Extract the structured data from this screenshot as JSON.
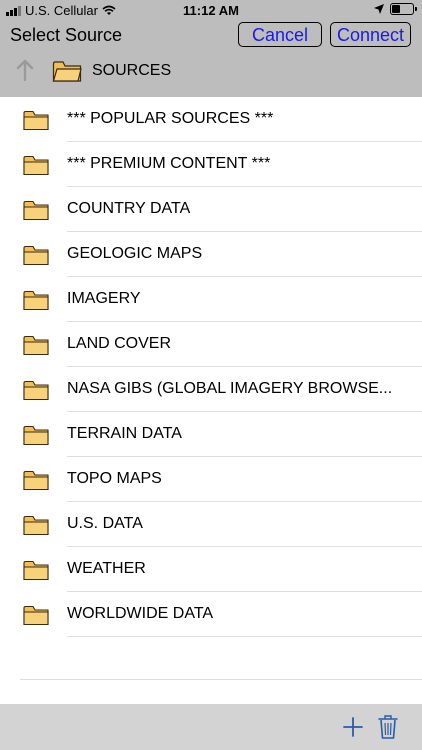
{
  "status_bar": {
    "carrier": "U.S. Cellular",
    "time": "11:12 AM"
  },
  "header": {
    "title": "Select Source",
    "cancel_label": "Cancel",
    "connect_label": "Connect",
    "current_folder": "SOURCES"
  },
  "list": {
    "items": [
      {
        "label": "*** POPULAR SOURCES ***"
      },
      {
        "label": "*** PREMIUM CONTENT ***"
      },
      {
        "label": "COUNTRY DATA"
      },
      {
        "label": "GEOLOGIC MAPS"
      },
      {
        "label": "IMAGERY"
      },
      {
        "label": "LAND COVER"
      },
      {
        "label": "NASA GIBS (GLOBAL IMAGERY BROWSE..."
      },
      {
        "label": "TERRAIN DATA"
      },
      {
        "label": "TOPO MAPS"
      },
      {
        "label": "U.S. DATA"
      },
      {
        "label": "WEATHER"
      },
      {
        "label": "WORLDWIDE DATA"
      }
    ]
  },
  "colors": {
    "folder_fill": "#f7d27a",
    "folder_stroke": "#3a2a10",
    "button_text": "#1a1af0",
    "header_bg": "#bdbdbd"
  }
}
